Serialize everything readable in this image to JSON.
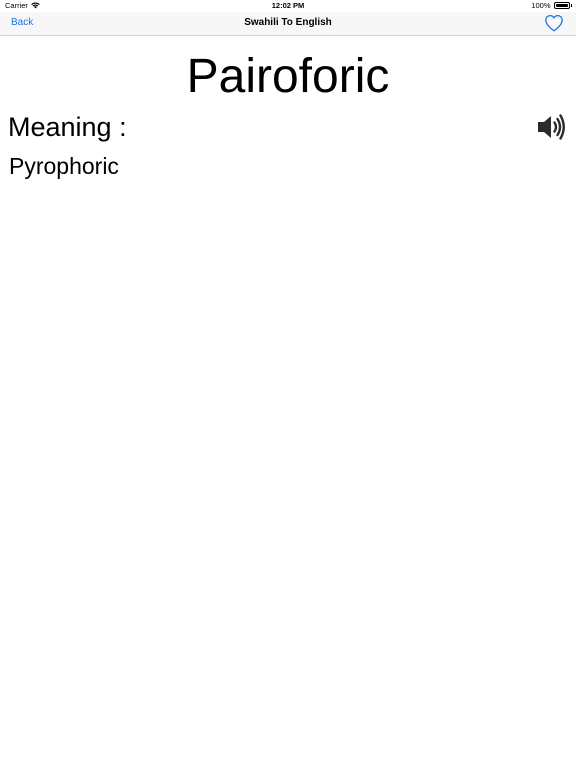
{
  "status_bar": {
    "carrier": "Carrier",
    "time": "12:02 PM",
    "battery": "100%",
    "wifi_icon": "wifi-icon",
    "battery_icon": "battery-icon"
  },
  "nav": {
    "back_label": "Back",
    "title": "Swahili To English",
    "favorite_icon": "heart-outline-icon",
    "accent_color": "#1a73e8"
  },
  "entry": {
    "word": "Pairoforic",
    "meaning_label": "Meaning :",
    "meaning": "Pyrophoric",
    "speaker_icon": "speaker-icon"
  }
}
